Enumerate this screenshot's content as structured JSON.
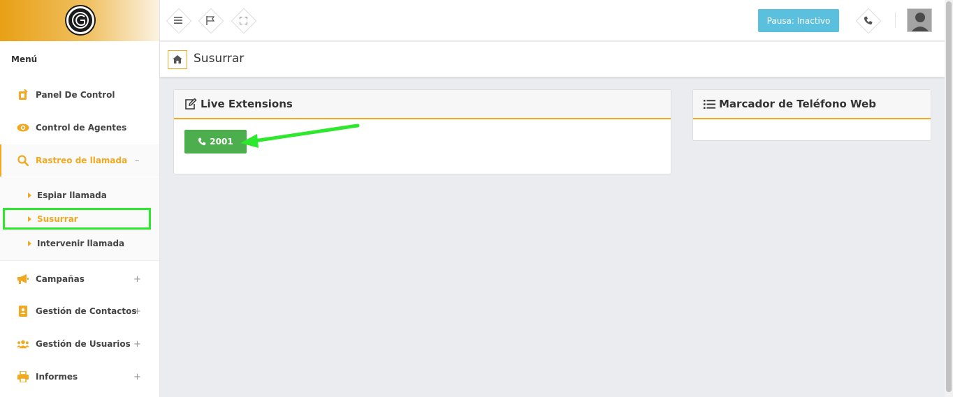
{
  "sidebar": {
    "menu_title": "Menú",
    "items": [
      {
        "label": "Panel De Control",
        "icon": "tablet-icon"
      },
      {
        "label": "Control de Agentes",
        "icon": "eye-icon"
      },
      {
        "label": "Rastreo de llamada",
        "icon": "search-icon",
        "toggle": "–"
      },
      {
        "label": "Campañas",
        "icon": "bullhorn-icon",
        "toggle": "+"
      },
      {
        "label": "Gestión de Contactos",
        "icon": "address-book-icon",
        "toggle": "+"
      },
      {
        "label": "Gestión de Usuarios",
        "icon": "users-icon",
        "toggle": "+"
      },
      {
        "label": "Informes",
        "icon": "print-icon",
        "toggle": "+"
      }
    ],
    "subitems": [
      {
        "label": "Espiar llamada"
      },
      {
        "label": "Susurrar"
      },
      {
        "label": "Intervenir llamada"
      }
    ]
  },
  "topbar": {
    "pausa_label": "Pausa: Inactivo"
  },
  "header": {
    "title": "Susurrar"
  },
  "panels": {
    "live_extensions": {
      "title": "Live Extensions",
      "extension_button": "2001"
    },
    "marcador": {
      "title": "Marcador de Teléfono Web"
    }
  },
  "colors": {
    "accent": "#f0a921",
    "info": "#5bc0de",
    "success": "#4cae4c",
    "annotation": "#2ee82e"
  }
}
